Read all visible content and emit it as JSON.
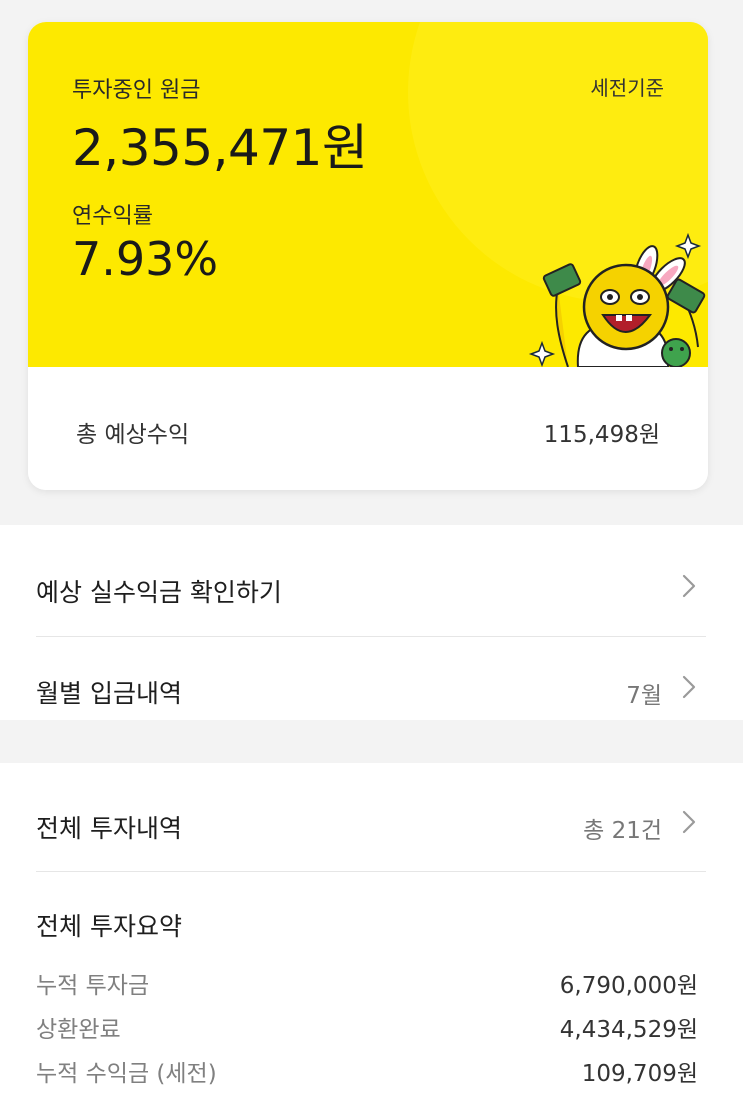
{
  "card": {
    "principal_label": "투자중인 원금",
    "principal_value": "2,355,471원",
    "basis_label": "세전기준",
    "rate_label": "연수익률",
    "rate_value": "7.93%",
    "expected_label": "총 예상수익",
    "expected_value": "115,498원"
  },
  "menu": {
    "items": [
      {
        "label": "예상 실수익금 확인하기",
        "meta": ""
      },
      {
        "label": "월별 입금내역",
        "meta": "7월"
      }
    ]
  },
  "history": {
    "label": "전체 투자내역",
    "meta": "총 21건"
  },
  "summary": {
    "title": "전체 투자요약",
    "rows": [
      {
        "label": "누적 투자금",
        "value": "6,790,000원"
      },
      {
        "label": "상환완료",
        "value": "4,434,529원"
      },
      {
        "label": "누적 수익금 (세전)",
        "value": "109,709원"
      }
    ]
  },
  "colors": {
    "brand_yellow": "#fde900",
    "chevron": "#9a9a9a"
  },
  "icons": {
    "chevron": "chevron-right-icon",
    "mascot": "mascot-illustration"
  }
}
